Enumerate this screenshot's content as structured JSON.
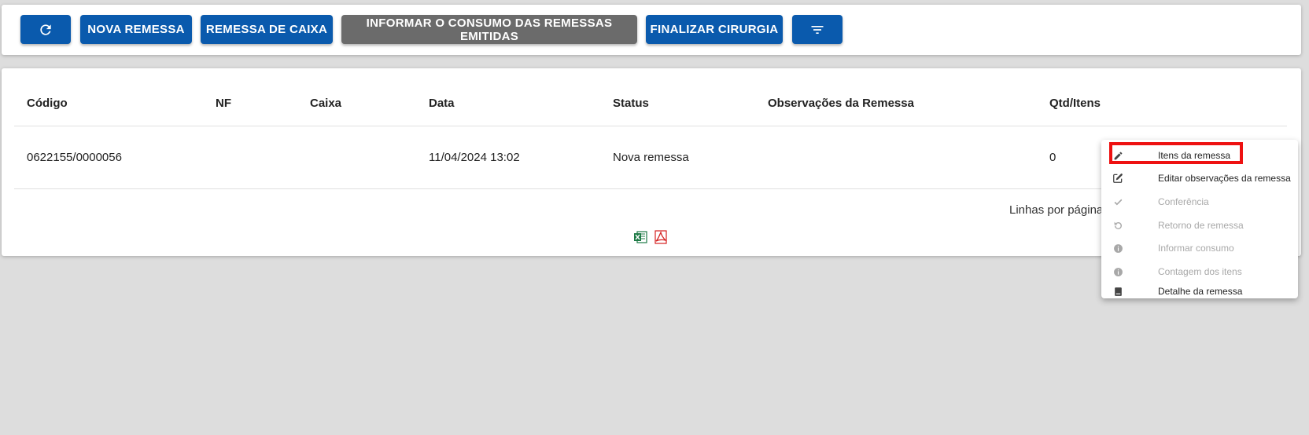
{
  "toolbar": {
    "refresh_icon": "refresh-icon",
    "nova_remessa": "NOVA REMESSA",
    "remessa_de_caixa": "REMESSA DE CAIXA",
    "informar_consumo": "INFORMAR O CONSUMO DAS REMESSAS EMITIDAS",
    "finalizar_cirurgia": "FINALIZAR CIRURGIA",
    "filter_icon": "filter-icon",
    "primary_color": "#0a5aad",
    "disabled_color": "#6b6b6b"
  },
  "table": {
    "columns": [
      "Código",
      "NF",
      "Caixa",
      "Data",
      "Status",
      "Observações da Remessa",
      "Qtd/Itens"
    ],
    "rows": [
      {
        "codigo": "0622155/0000056",
        "nf": "",
        "caixa": "",
        "data": "11/04/2024 13:02",
        "status": "Nova remessa",
        "observacoes": "",
        "qtd_itens": "0"
      }
    ],
    "lines_per_page_label": "Linhas por página:",
    "export_icons": [
      "excel-icon",
      "pdf-icon"
    ]
  },
  "context_menu": {
    "items": [
      {
        "label": "Itens da remessa",
        "icon": "pencil-icon",
        "enabled": true
      },
      {
        "label": "Editar observações da remessa",
        "icon": "edit-icon",
        "enabled": true
      },
      {
        "label": "Conferência",
        "icon": "check-icon",
        "enabled": false
      },
      {
        "label": "Retorno de remessa",
        "icon": "undo-icon",
        "enabled": false
      },
      {
        "label": "Informar consumo",
        "icon": "info-icon",
        "enabled": false
      },
      {
        "label": "Contagem dos itens",
        "icon": "info-icon",
        "enabled": false
      },
      {
        "label": "Detalhe da remessa",
        "icon": "book-icon",
        "enabled": true
      }
    ],
    "highlight_color": "#ee1111"
  }
}
